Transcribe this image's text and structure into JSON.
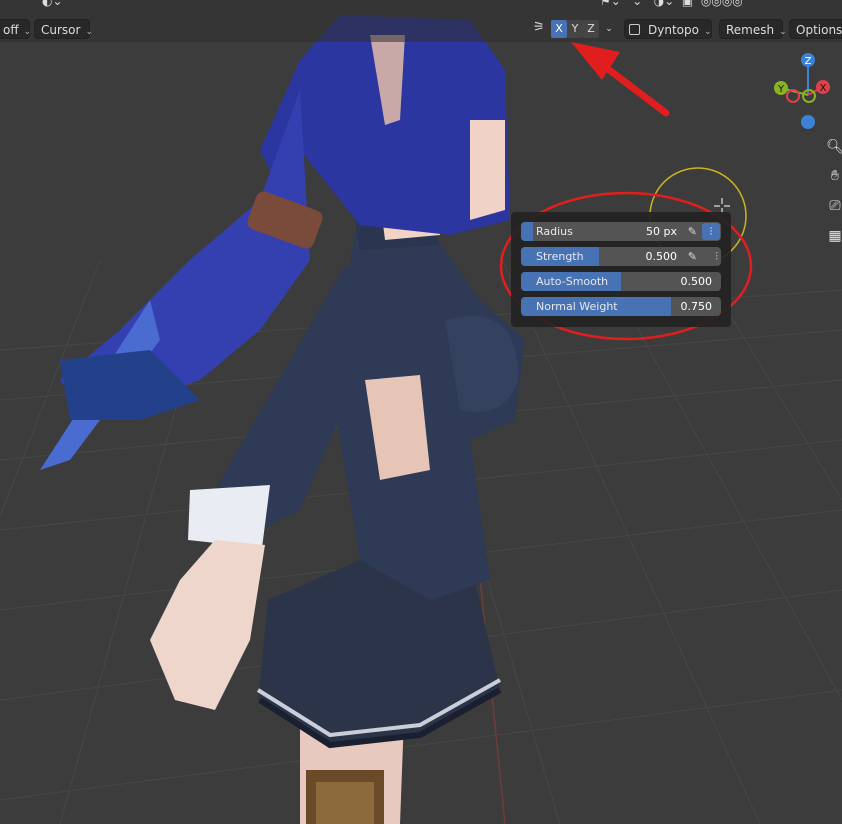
{
  "header": {
    "snap_label": "off",
    "transform_pivot_label": "Cursor",
    "symmetry": {
      "x": "X",
      "y": "Y",
      "z": "Z",
      "active": "X"
    },
    "dyntopo_label": "Dyntopo",
    "remesh_label": "Remesh",
    "options_label": "Options"
  },
  "brush_popup": {
    "radius": {
      "label": "Radius",
      "value": "50 px"
    },
    "strength": {
      "label": "Strength",
      "value": "0.500",
      "fill": 0.5
    },
    "auto_smooth": {
      "label": "Auto-Smooth",
      "value": "0.500",
      "fill": 0.5
    },
    "normal_weight": {
      "label": "Normal Weight",
      "value": "0.750",
      "fill": 0.75
    }
  },
  "gizmo": {
    "z": "Z",
    "y": "Y",
    "x": "X"
  },
  "colors": {
    "accent": "#4772b3",
    "annotation_red": "#e01e1e",
    "axis_x": "#e0404a",
    "axis_y": "#88b424",
    "axis_z": "#3b82d6",
    "brush_circle": "#c8b41e"
  },
  "icons": [
    "symmetry-icon",
    "checkbox-icon",
    "zoom-icon",
    "hand-icon",
    "camera-icon",
    "grid-icon",
    "pressure-icon",
    "lock-icon"
  ]
}
